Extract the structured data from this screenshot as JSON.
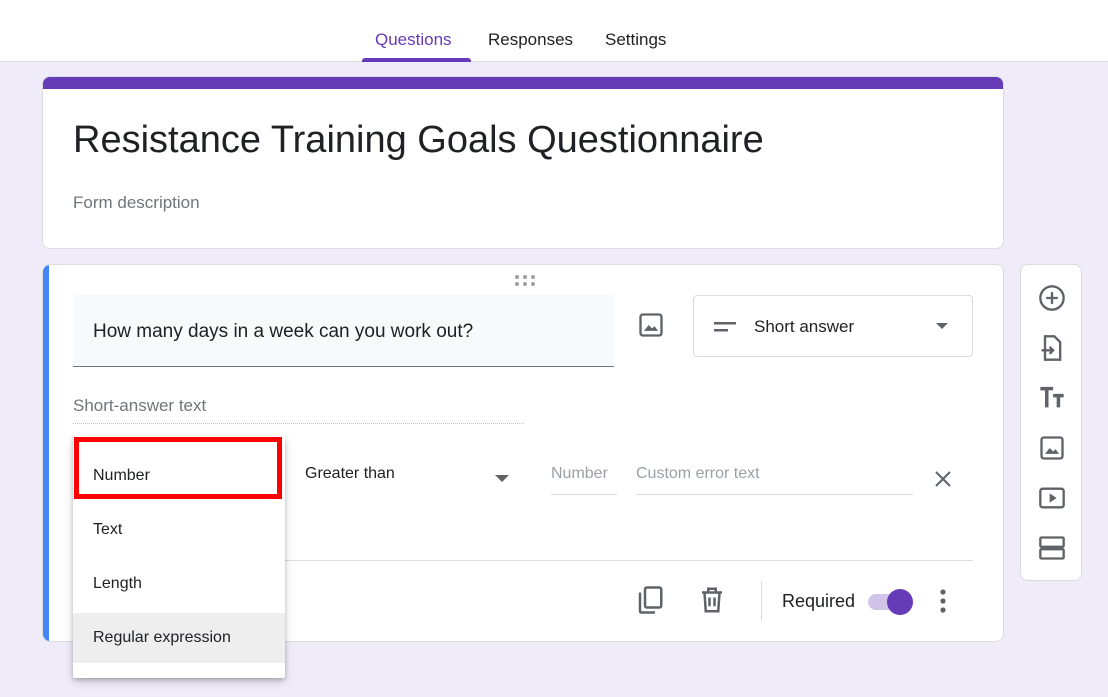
{
  "tabs": [
    {
      "label": "Questions",
      "active": true
    },
    {
      "label": "Responses",
      "active": false
    },
    {
      "label": "Settings",
      "active": false
    }
  ],
  "form": {
    "title": "Resistance Training Goals Questionnaire",
    "description_placeholder": "Form description"
  },
  "question": {
    "title": "How many days in a week can you work out?",
    "type_label": "Short answer",
    "answer_placeholder": "Short-answer text",
    "validation": {
      "condition": "Greater than",
      "number_placeholder": "Number",
      "error_placeholder": "Custom error text"
    },
    "required_label": "Required",
    "required": true
  },
  "dropdown": {
    "items": [
      {
        "label": "Number",
        "highlighted": true
      },
      {
        "label": "Text"
      },
      {
        "label": "Length"
      },
      {
        "label": "Regular expression",
        "hovered": true
      }
    ]
  },
  "sidebar": {
    "icons": [
      "add-question-icon",
      "import-questions-icon",
      "add-title-icon",
      "add-image-icon",
      "add-video-icon",
      "add-section-icon"
    ]
  },
  "colors": {
    "accent": "#673ab7",
    "active_question": "#4285f4",
    "background": "#f0ebf8",
    "highlight": "#ff0000"
  }
}
